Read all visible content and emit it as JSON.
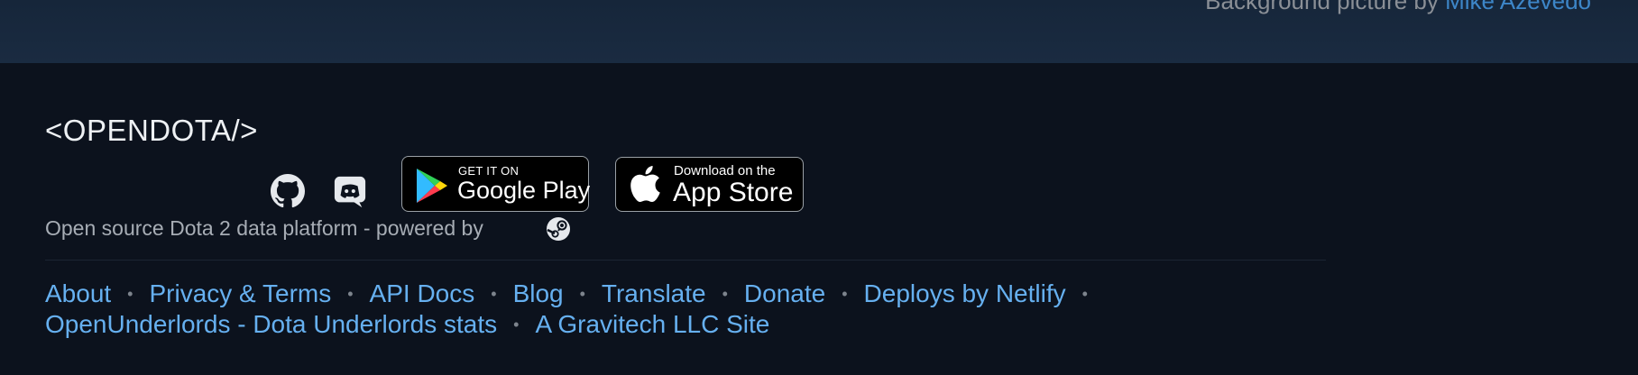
{
  "background_credit": {
    "prefix": "Background picture by",
    "author": "Mike Azevedo"
  },
  "brand": {
    "logo_text": "<OPENDOTA/>",
    "tagline": "Open source Dota 2 data platform - powered by"
  },
  "social": {
    "github_icon": "github-icon",
    "discord_icon": "discord-icon"
  },
  "stores": {
    "google_play": {
      "small": "GET IT ON",
      "big": "Google Play"
    },
    "app_store": {
      "small": "Download on the",
      "big": "App Store"
    }
  },
  "footer_links": {
    "row1": [
      "About",
      "Privacy & Terms",
      "API Docs",
      "Blog",
      "Translate",
      "Donate",
      "Deploys by Netlify"
    ],
    "row2": [
      "OpenUnderlords - Dota Underlords stats",
      "A Gravitech LLC Site"
    ],
    "separator": "•"
  },
  "colors": {
    "page_bg": "#0c121d",
    "link": "#66b0f0",
    "muted_text": "#a7adb5"
  }
}
